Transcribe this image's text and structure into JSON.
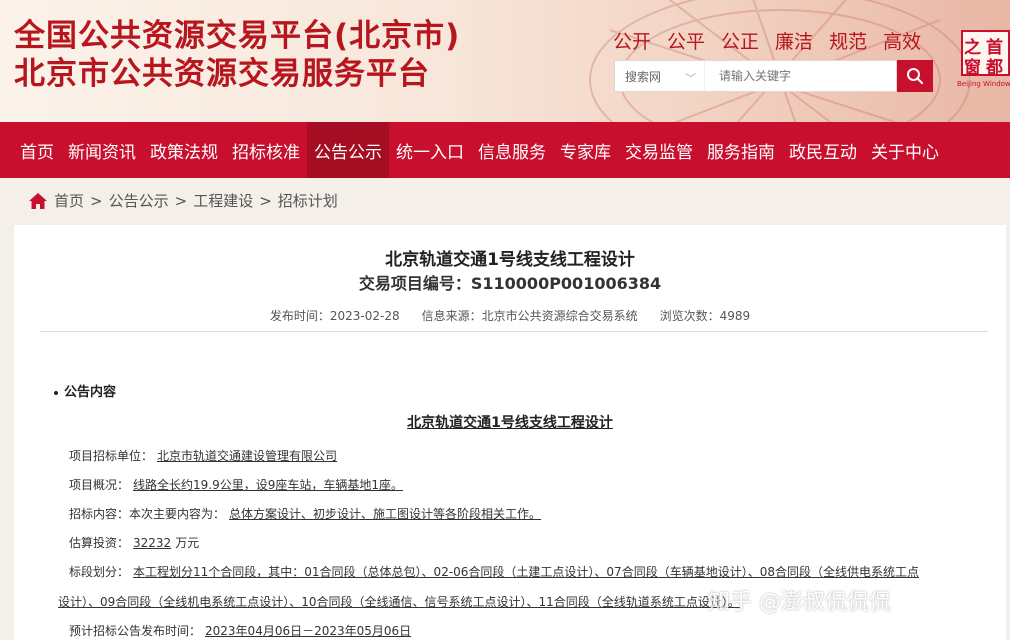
{
  "header": {
    "title_line1": "全国公共资源交易平台(北京市)",
    "title_line2": "北京市公共资源交易服务平台",
    "slogans": [
      "公开",
      "公平",
      "公正",
      "廉洁",
      "规范",
      "高效"
    ],
    "search": {
      "scope": "搜索网",
      "placeholder": "请输入关键字"
    },
    "seal": {
      "chars": [
        "之",
        "首",
        "窗",
        "都"
      ],
      "sub": "Beijing Window"
    }
  },
  "nav": {
    "items": [
      "首页",
      "新闻资讯",
      "政策法规",
      "招标核准",
      "公告公示",
      "统一入口",
      "信息服务",
      "专家库",
      "交易监管",
      "服务指南",
      "政民互动",
      "关于中心"
    ],
    "active": "公告公示"
  },
  "breadcrumb": [
    "首页",
    "公告公示",
    "工程建设",
    "招标计划"
  ],
  "article": {
    "title": "北京轨道交通1号线支线工程设计",
    "code": "交易项目编号：S110000P001006384",
    "publish_time": "发布时间：2023-02-28",
    "source": "信息来源：北京市公共资源综合交易系统",
    "views": "浏览次数：4989"
  },
  "notice": {
    "section_label": "公告内容",
    "title": "北京轨道交通1号线支线工程设计",
    "rows": [
      {
        "label": "项目招标单位：",
        "value": "北京市轨道交通建设管理有限公司"
      },
      {
        "label": "项目概况：",
        "value": "线路全长约19.9公里，设9座车站，车辆基地1座。"
      },
      {
        "label": "招标内容：本次主要内容为：",
        "value": "总体方案设计、初步设计、施工图设计等各阶段相关工作。"
      },
      {
        "label": "估算投资：",
        "value": "32232",
        "suffix": "万元"
      },
      {
        "label": "标段划分：",
        "value": "本工程划分11个合同段，其中：01合同段（总体总包）、02-06合同段（土建工点设计）、07合同段（车辆基地设计）、08合同段（全线供电系统工点"
      },
      {
        "label": "",
        "value": "设计）、09合同段（全线机电系统工点设计）、10合同段（全线通信、信号系统工点设计）、11合同段（全线轨道系统工点设计）。"
      },
      {
        "label": "预计招标公告发布时间：",
        "value": "2023年04月06日－2023年05月06日"
      }
    ]
  },
  "watermark": "知乎 @澎叔侃侃侃"
}
